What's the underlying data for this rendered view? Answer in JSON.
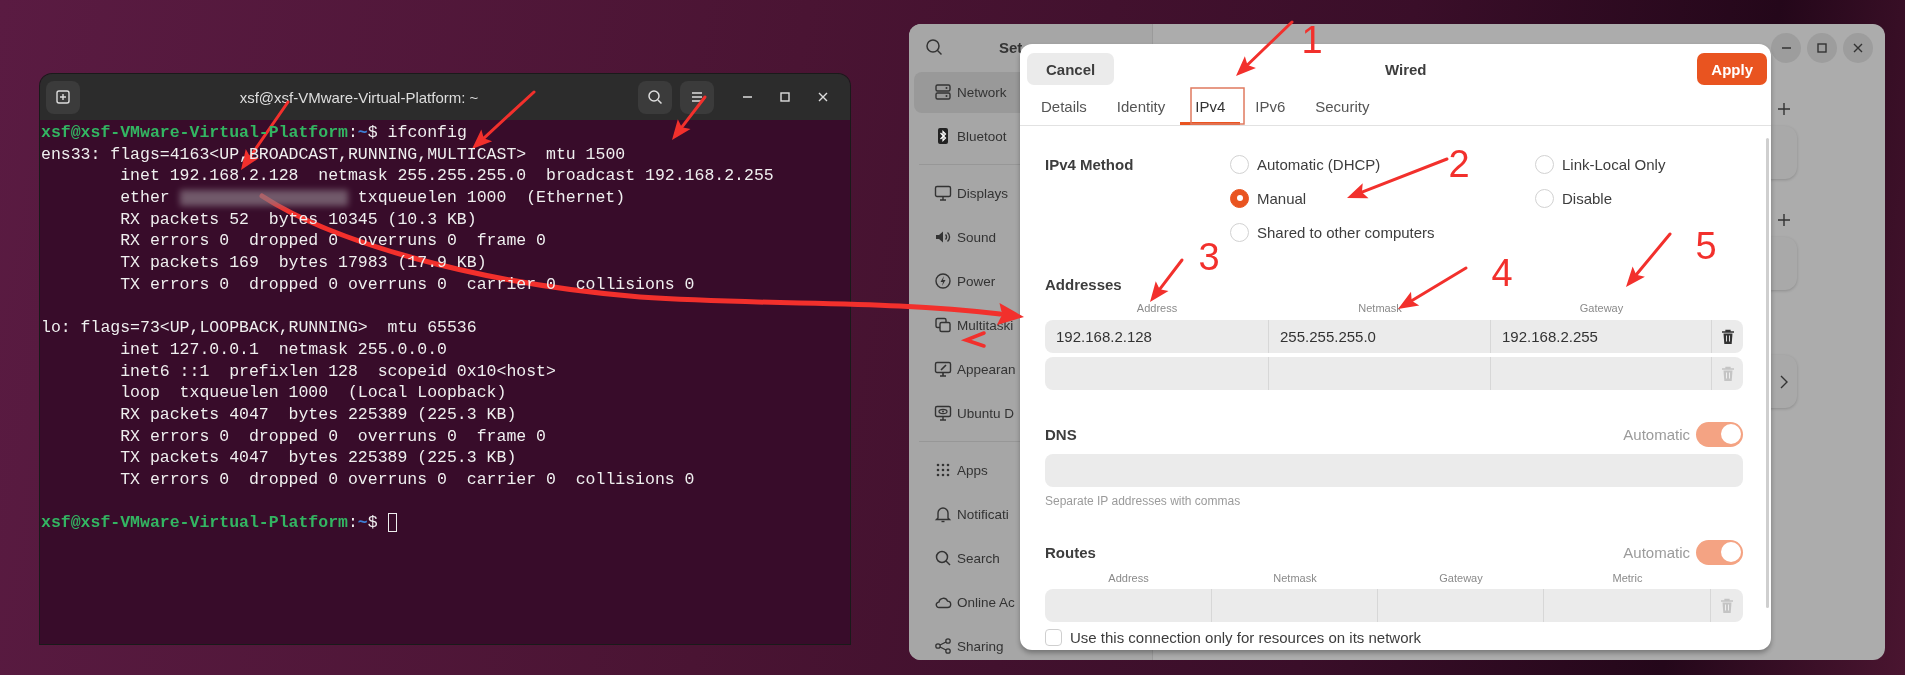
{
  "terminal": {
    "title": "xsf@xsf-VMware-Virtual-Platform: ~",
    "lines": [
      {
        "kind": "prompt",
        "user": "xsf@xsf-VMware-Virtual-Platform",
        "sep": ":",
        "path": "~",
        "symbol": "$",
        "command": "ifconfig",
        "cursor": false
      },
      {
        "kind": "text",
        "text": "ens33: flags=4163<UP,BROADCAST,RUNNING,MULTICAST>  mtu 1500"
      },
      {
        "kind": "text",
        "text": "        inet 192.168.2.128  netmask 255.255.255.0  broadcast 192.168.2.255"
      },
      {
        "kind": "masked",
        "before": "        ether",
        "after": "txqueuelen 1000  (Ethernet)"
      },
      {
        "kind": "text",
        "text": "        RX packets 52  bytes 10345 (10.3 KB)"
      },
      {
        "kind": "text",
        "text": "        RX errors 0  dropped 0  overruns 0  frame 0"
      },
      {
        "kind": "text",
        "text": "        TX packets 169  bytes 17983 (17.9 KB)"
      },
      {
        "kind": "text",
        "text": "        TX errors 0  dropped 0 overruns 0  carrier 0  collisions 0"
      },
      {
        "kind": "blank"
      },
      {
        "kind": "text",
        "text": "lo: flags=73<UP,LOOPBACK,RUNNING>  mtu 65536"
      },
      {
        "kind": "text",
        "text": "        inet 127.0.0.1  netmask 255.0.0.0"
      },
      {
        "kind": "text",
        "text": "        inet6 ::1  prefixlen 128  scopeid 0x10<host>"
      },
      {
        "kind": "text",
        "text": "        loop  txqueuelen 1000  (Local Loopback)"
      },
      {
        "kind": "text",
        "text": "        RX packets 4047  bytes 225389 (225.3 KB)"
      },
      {
        "kind": "text",
        "text": "        RX errors 0  dropped 0  overruns 0  frame 0"
      },
      {
        "kind": "text",
        "text": "        TX packets 4047  bytes 225389 (225.3 KB)"
      },
      {
        "kind": "text",
        "text": "        TX errors 0  dropped 0 overruns 0  carrier 0  collisions 0"
      },
      {
        "kind": "blank"
      },
      {
        "kind": "prompt",
        "user": "xsf@xsf-VMware-Virtual-Platform",
        "sep": ":",
        "path": "~",
        "symbol": "$",
        "cursor": true
      }
    ]
  },
  "settings": {
    "title": "Set",
    "sidebar_groups": [
      {
        "items": [
          {
            "label": "Network",
            "selected": true
          },
          {
            "label": "Bluetoot",
            "selected": false
          }
        ]
      },
      {
        "items": [
          {
            "label": "Displays",
            "selected": false
          },
          {
            "label": "Sound",
            "selected": false
          },
          {
            "label": "Power",
            "selected": false
          },
          {
            "label": "Multitaski",
            "selected": false
          },
          {
            "label": "Appearan",
            "selected": false
          },
          {
            "label": "Ubuntu D",
            "selected": false
          }
        ]
      },
      {
        "items": [
          {
            "label": "Apps",
            "selected": false
          },
          {
            "label": "Notificati",
            "selected": false
          },
          {
            "label": "Search",
            "selected": false
          },
          {
            "label": "Online Ac",
            "selected": false
          },
          {
            "label": "Sharing",
            "selected": false
          }
        ]
      }
    ]
  },
  "dialog": {
    "cancel": "Cancel",
    "title": "Wired",
    "apply": "Apply",
    "tabs": [
      {
        "label": "Details",
        "selected": false
      },
      {
        "label": "Identity",
        "selected": false
      },
      {
        "label": "IPv4",
        "selected": true
      },
      {
        "label": "IPv6",
        "selected": false
      },
      {
        "label": "Security",
        "selected": false
      }
    ],
    "method": {
      "label": "IPv4 Method",
      "options": [
        {
          "label": "Automatic (DHCP)",
          "selected": false
        },
        {
          "label": "Manual",
          "selected": true
        },
        {
          "label": "Shared to other computers",
          "selected": false
        },
        {
          "label": "Link-Local Only",
          "selected": false
        },
        {
          "label": "Disable",
          "selected": false
        }
      ]
    },
    "addresses": {
      "label": "Addresses",
      "columns": [
        "Address",
        "Netmask",
        "Gateway"
      ],
      "rows": [
        {
          "cells": [
            "192.168.2.128",
            "255.255.255.0",
            "192.168.2.255"
          ],
          "delete_disabled": false
        },
        {
          "delete_disabled": true
        }
      ]
    },
    "dns": {
      "label": "DNS",
      "toggle_label": "Automatic",
      "on": true,
      "hint": "Separate IP addresses with commas"
    },
    "routes": {
      "label": "Routes",
      "toggle_label": "Automatic",
      "on": true,
      "columns": [
        "Address",
        "Netmask",
        "Gateway",
        "Metric"
      ],
      "rows": [
        {
          "delete_disabled": true
        }
      ]
    },
    "only_local": {
      "label": "Use this connection only for resources on its network",
      "checked": false
    }
  },
  "annotations": {
    "numbers": [
      "1",
      "2",
      "3",
      "4",
      "5"
    ]
  }
}
